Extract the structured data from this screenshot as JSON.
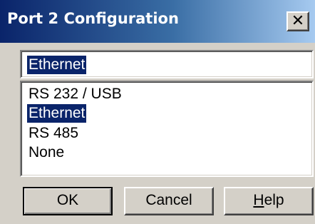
{
  "window": {
    "title": "Port 2 Configuration",
    "close_icon": "close-icon"
  },
  "edit": {
    "value": "Ethernet"
  },
  "listbox": {
    "items": [
      {
        "label": "RS 232 / USB",
        "selected": false
      },
      {
        "label": "Ethernet",
        "selected": true
      },
      {
        "label": "RS 485",
        "selected": false
      },
      {
        "label": "None",
        "selected": false
      }
    ]
  },
  "buttons": {
    "ok": "OK",
    "cancel": "Cancel",
    "help": "Help",
    "help_mnemonic": "H",
    "help_rest": "elp"
  },
  "colors": {
    "face": "#d4d0c8",
    "selection": "#0a246a",
    "title_gradient_start": "#0a246a",
    "title_gradient_end": "#a6caf0"
  }
}
